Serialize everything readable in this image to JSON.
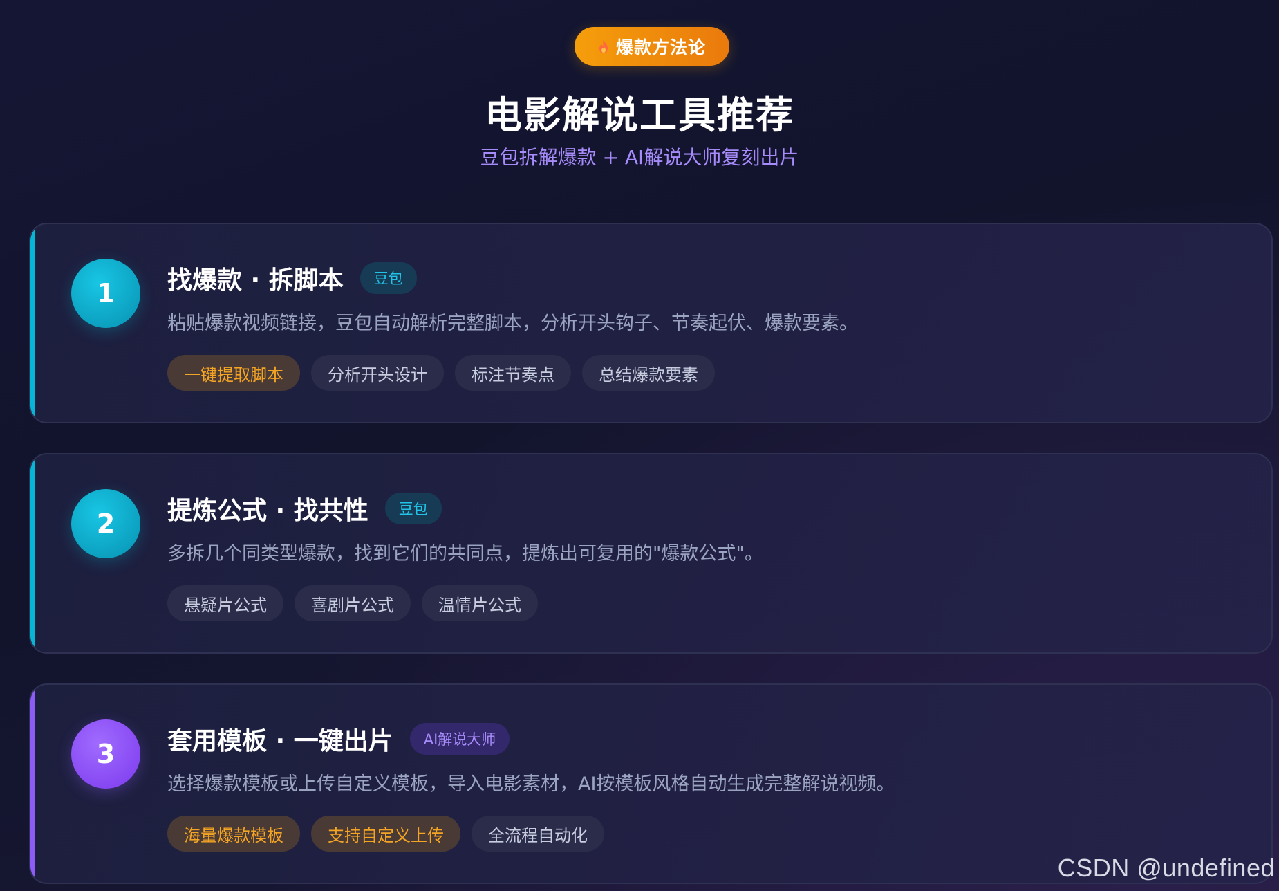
{
  "header": {
    "badge_label": "爆款方法论",
    "title": "电影解说工具推荐",
    "subtitle": "豆包拆解爆款 + AI解说大师复刻出片"
  },
  "cards": [
    {
      "number": "1",
      "title": "找爆款 · 拆脚本",
      "tool": "豆包",
      "description": "粘贴爆款视频链接，豆包自动解析完整脚本，分析开头钩子、节奏起伏、爆款要素。",
      "chips": [
        {
          "label": "一键提取脚本",
          "highlight": true
        },
        {
          "label": "分析开头设计",
          "highlight": false
        },
        {
          "label": "标注节奏点",
          "highlight": false
        },
        {
          "label": "总结爆款要素",
          "highlight": false
        }
      ]
    },
    {
      "number": "2",
      "title": "提炼公式 · 找共性",
      "tool": "豆包",
      "description": "多拆几个同类型爆款，找到它们的共同点，提炼出可复用的\"爆款公式\"。",
      "chips": [
        {
          "label": "悬疑片公式",
          "highlight": false
        },
        {
          "label": "喜剧片公式",
          "highlight": false
        },
        {
          "label": "温情片公式",
          "highlight": false
        }
      ]
    },
    {
      "number": "3",
      "title": "套用模板 · 一键出片",
      "tool": "AI解说大师",
      "description": "选择爆款模板或上传自定义模板，导入电影素材，AI按模板风格自动生成完整解说视频。",
      "chips": [
        {
          "label": "海量爆款模板",
          "highlight": true
        },
        {
          "label": "支持自定义上传",
          "highlight": true
        },
        {
          "label": "全流程自动化",
          "highlight": false
        }
      ]
    }
  ],
  "colors": {
    "accent_cyan": "#06b6d4",
    "accent_purple": "#8b5cf6",
    "badge_orange": "#f59e0b",
    "highlight_chip_text": "#f5a524"
  },
  "icons": {
    "badge_icon": "flame-icon"
  },
  "watermark": "CSDN @undefined"
}
